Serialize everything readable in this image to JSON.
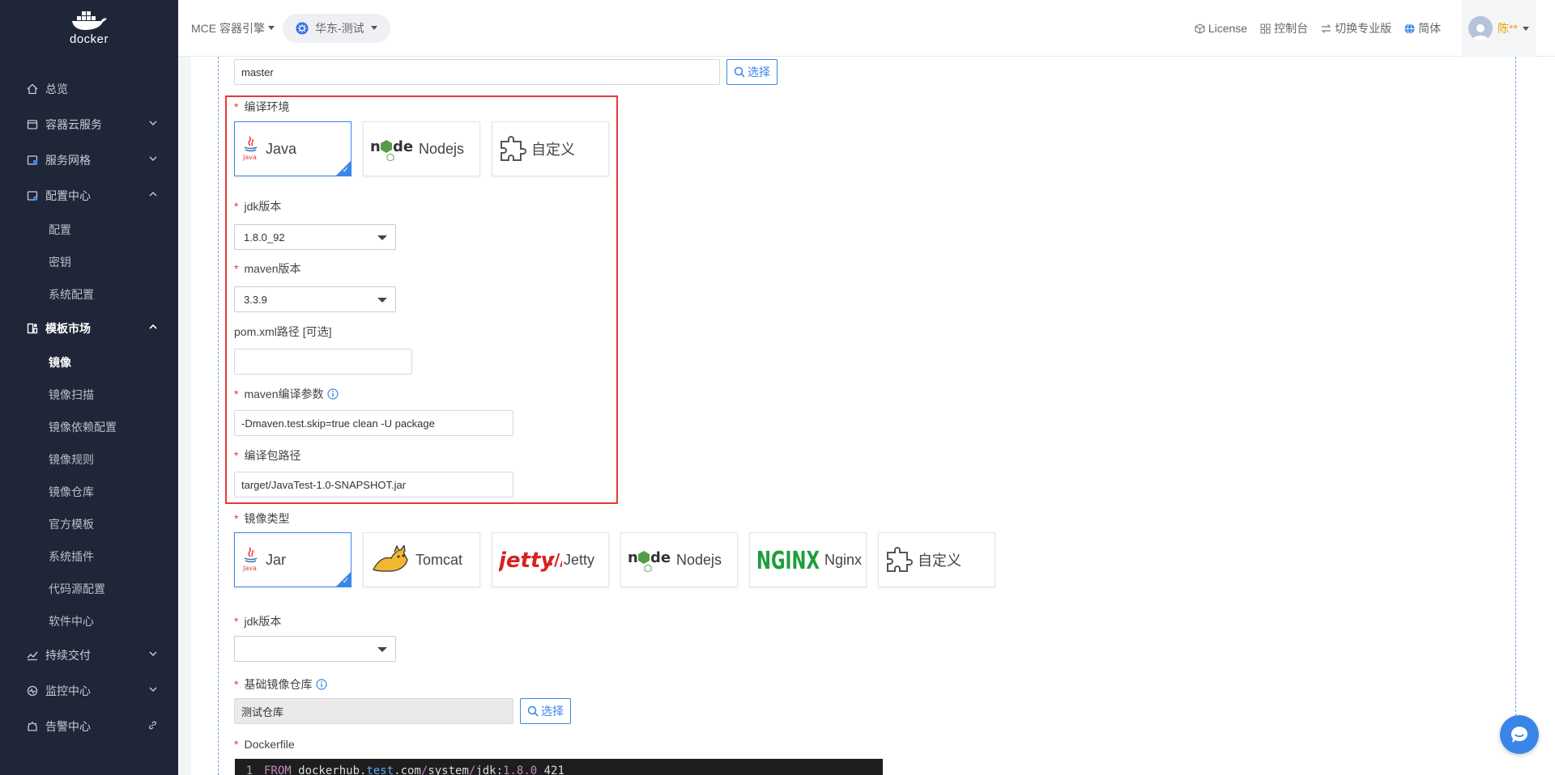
{
  "app": {
    "logo_text": "docker"
  },
  "sidebar": {
    "items": [
      {
        "label": "总览",
        "icon": "home-icon"
      },
      {
        "label": "容器云服务",
        "icon": "container-icon",
        "expandable": true
      },
      {
        "label": "服务网格",
        "icon": "mesh-icon",
        "expandable": true
      },
      {
        "label": "配置中心",
        "icon": "config-icon",
        "expanded": true,
        "children": [
          "配置",
          "密钥",
          "系统配置"
        ]
      },
      {
        "label": "模板市场",
        "icon": "template-icon",
        "expanded": true,
        "active": true,
        "children": [
          "镜像",
          "镜像扫描",
          "镜像依赖配置",
          "镜像规则",
          "镜像仓库",
          "官方模板",
          "系统插件",
          "代码源配置",
          "软件中心"
        ],
        "active_child": "镜像"
      },
      {
        "label": "持续交付",
        "icon": "delivery-icon",
        "expandable": true
      },
      {
        "label": "监控中心",
        "icon": "monitor-icon",
        "expandable": true
      },
      {
        "label": "告警中心",
        "icon": "alarm-icon",
        "link": true
      }
    ]
  },
  "header": {
    "engine": "MCE 容器引擎",
    "region": "华东-测试",
    "links": [
      {
        "label": "License",
        "icon": "cube-icon"
      },
      {
        "label": "控制台",
        "icon": "grid-icon"
      },
      {
        "label": "切换专业版",
        "icon": "switch-icon"
      },
      {
        "label": "简体",
        "icon": "globe-icon"
      }
    ],
    "user": "陈**"
  },
  "form": {
    "branch_value": "master",
    "select_label": "选择",
    "compile_env": {
      "label": "编译环境",
      "options": [
        "Java",
        "Nodejs",
        "自定义"
      ],
      "selected": "Java"
    },
    "jdk_version": {
      "label": "jdk版本",
      "value": "1.8.0_92"
    },
    "maven_version": {
      "label": "maven版本",
      "value": "3.3.9"
    },
    "pom_path": {
      "label": "pom.xml路径 [可选]",
      "value": ""
    },
    "maven_args": {
      "label": "maven编译参数",
      "value": "-Dmaven.test.skip=true clean -U package"
    },
    "package_path": {
      "label": "编译包路径",
      "value": "target/JavaTest-1.0-SNAPSHOT.jar"
    },
    "image_type": {
      "label": "镜像类型",
      "options": [
        "Jar",
        "Tomcat",
        "Jetty",
        "Nodejs",
        "Nginx",
        "自定义"
      ],
      "selected": "Jar"
    },
    "image_jdk_version": {
      "label": "jdk版本",
      "value": ""
    },
    "base_repo": {
      "label": "基础镜像仓库",
      "value": "测试仓库"
    },
    "dockerfile": {
      "label": "Dockerfile",
      "line_no": "1",
      "kw": "FROM",
      "p1": " dockerhub.",
      "p2": "test",
      "p3": ".com",
      "p4": "/",
      "p5": "system",
      "p6": "/",
      "p7": "jdk:",
      "p8": "1.8.0",
      "p9": "_421"
    }
  },
  "colors": {
    "accent": "#3a86e8",
    "highlight_border": "#e53935",
    "sidebar_bg": "#1f2637"
  }
}
